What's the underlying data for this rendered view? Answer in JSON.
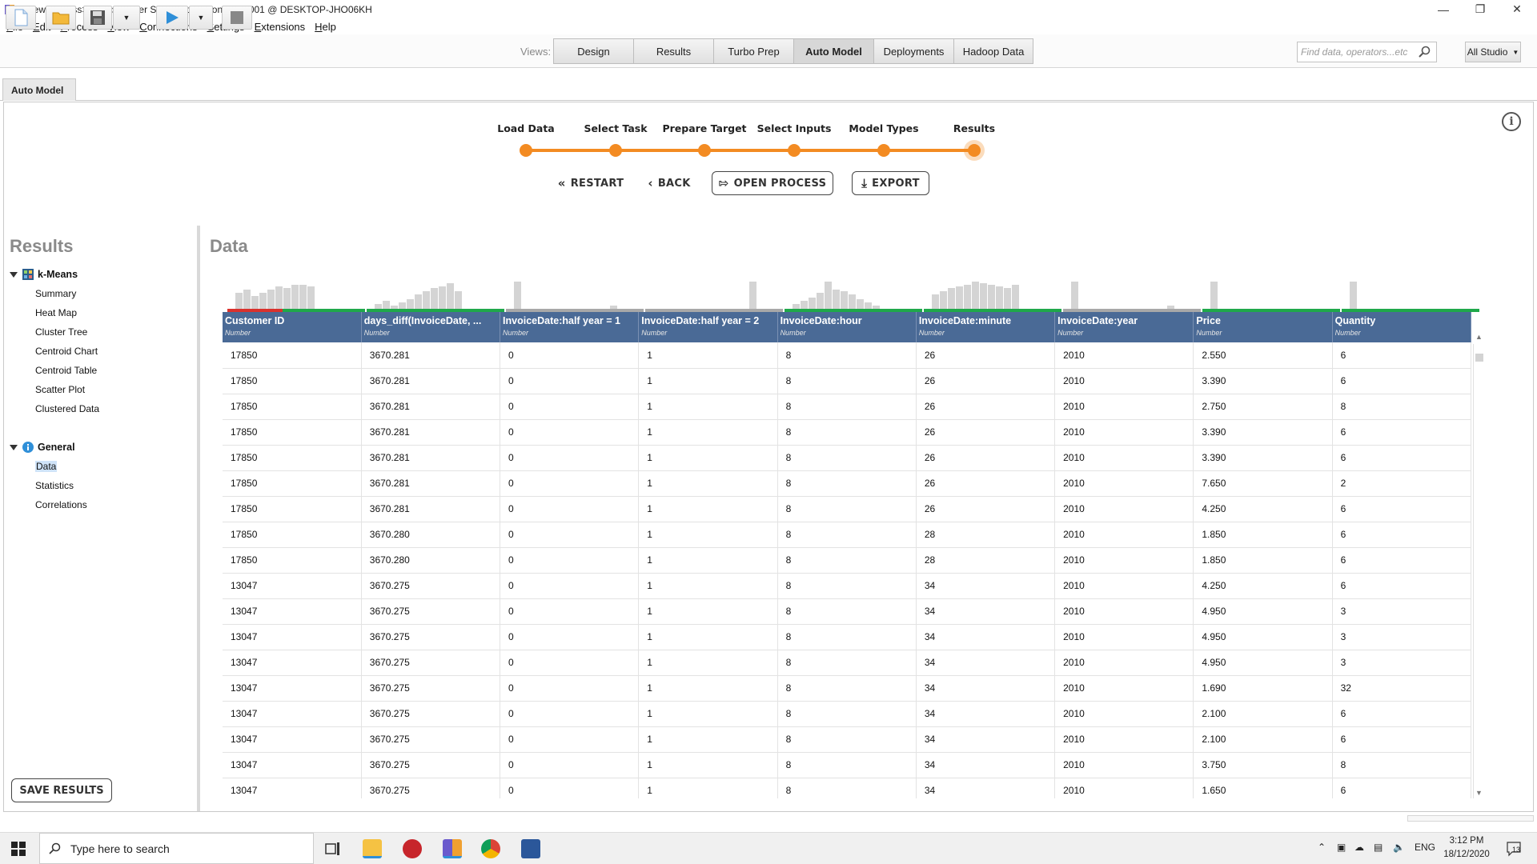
{
  "window": {
    "title": "<new process> – RapidMiner Studio Educational 9.8.001 @ DESKTOP-JHO06KH"
  },
  "menu": [
    "File",
    "Edit",
    "Process",
    "View",
    "Connections",
    "Settings",
    "Extensions",
    "Help"
  ],
  "toolbar": {
    "views_label": "Views:",
    "views": [
      {
        "label": "Design",
        "active": false
      },
      {
        "label": "Results",
        "active": false
      },
      {
        "label": "Turbo Prep",
        "active": false
      },
      {
        "label": "Auto Model",
        "active": true
      },
      {
        "label": "Deployments",
        "active": false
      },
      {
        "label": "Hadoop Data",
        "active": false
      }
    ],
    "search_placeholder": "Find data, operators...etc",
    "scope_label": "All Studio"
  },
  "doc_tab": "Auto Model",
  "stepper": {
    "steps": [
      "Load Data",
      "Select Task",
      "Prepare Target",
      "Select Inputs",
      "Model Types",
      "Results"
    ],
    "current_index": 5,
    "accent_color": "#f38b22"
  },
  "actions": {
    "restart": "RESTART",
    "back": "BACK",
    "open_process": "OPEN PROCESS",
    "export": "EXPORT"
  },
  "nav": {
    "heading": "Results",
    "groups": [
      {
        "label": "k-Means",
        "icon": "grid-icon",
        "items": [
          "Summary",
          "Heat Map",
          "Cluster Tree",
          "Centroid Chart",
          "Centroid Table",
          "Scatter Plot",
          "Clustered Data"
        ]
      },
      {
        "label": "General",
        "icon": "info-icon",
        "items": [
          "Data",
          "Statistics",
          "Correlations"
        ]
      }
    ],
    "selected": "Data",
    "save_button": "SAVE RESULTS"
  },
  "data_panel": {
    "heading": "Data",
    "columns": [
      {
        "name": "Customer ID",
        "type": "Number"
      },
      {
        "name": "days_diff(InvoiceDate, ...",
        "type": "Number"
      },
      {
        "name": "InvoiceDate:half year = 1",
        "type": "Number"
      },
      {
        "name": "InvoiceDate:half year = 2",
        "type": "Number"
      },
      {
        "name": "InvoiceDate:hour",
        "type": "Number"
      },
      {
        "name": "InvoiceDate:minute",
        "type": "Number"
      },
      {
        "name": "InvoiceDate:year",
        "type": "Number"
      },
      {
        "name": "Price",
        "type": "Number"
      },
      {
        "name": "Quantity",
        "type": "Number"
      }
    ],
    "rows": [
      [
        "17850",
        "3670.281",
        "0",
        "1",
        "8",
        "26",
        "2010",
        "2.550",
        "6"
      ],
      [
        "17850",
        "3670.281",
        "0",
        "1",
        "8",
        "26",
        "2010",
        "3.390",
        "6"
      ],
      [
        "17850",
        "3670.281",
        "0",
        "1",
        "8",
        "26",
        "2010",
        "2.750",
        "8"
      ],
      [
        "17850",
        "3670.281",
        "0",
        "1",
        "8",
        "26",
        "2010",
        "3.390",
        "6"
      ],
      [
        "17850",
        "3670.281",
        "0",
        "1",
        "8",
        "26",
        "2010",
        "3.390",
        "6"
      ],
      [
        "17850",
        "3670.281",
        "0",
        "1",
        "8",
        "26",
        "2010",
        "7.650",
        "2"
      ],
      [
        "17850",
        "3670.281",
        "0",
        "1",
        "8",
        "26",
        "2010",
        "4.250",
        "6"
      ],
      [
        "17850",
        "3670.280",
        "0",
        "1",
        "8",
        "28",
        "2010",
        "1.850",
        "6"
      ],
      [
        "17850",
        "3670.280",
        "0",
        "1",
        "8",
        "28",
        "2010",
        "1.850",
        "6"
      ],
      [
        "13047",
        "3670.275",
        "0",
        "1",
        "8",
        "34",
        "2010",
        "4.250",
        "6"
      ],
      [
        "13047",
        "3670.275",
        "0",
        "1",
        "8",
        "34",
        "2010",
        "4.950",
        "3"
      ],
      [
        "13047",
        "3670.275",
        "0",
        "1",
        "8",
        "34",
        "2010",
        "4.950",
        "3"
      ],
      [
        "13047",
        "3670.275",
        "0",
        "1",
        "8",
        "34",
        "2010",
        "4.950",
        "3"
      ],
      [
        "13047",
        "3670.275",
        "0",
        "1",
        "8",
        "34",
        "2010",
        "1.690",
        "32"
      ],
      [
        "13047",
        "3670.275",
        "0",
        "1",
        "8",
        "34",
        "2010",
        "2.100",
        "6"
      ],
      [
        "13047",
        "3670.275",
        "0",
        "1",
        "8",
        "34",
        "2010",
        "2.100",
        "6"
      ],
      [
        "13047",
        "3670.275",
        "0",
        "1",
        "8",
        "34",
        "2010",
        "3.750",
        "8"
      ],
      [
        "13047",
        "3670.275",
        "0",
        "1",
        "8",
        "34",
        "2010",
        "1.650",
        "6"
      ]
    ],
    "header_color": "#4a6a96"
  },
  "taskbar": {
    "search_placeholder": "Type here to search",
    "language": "ENG",
    "time": "3:12 PM",
    "date": "18/12/2020",
    "notifications": "13"
  }
}
